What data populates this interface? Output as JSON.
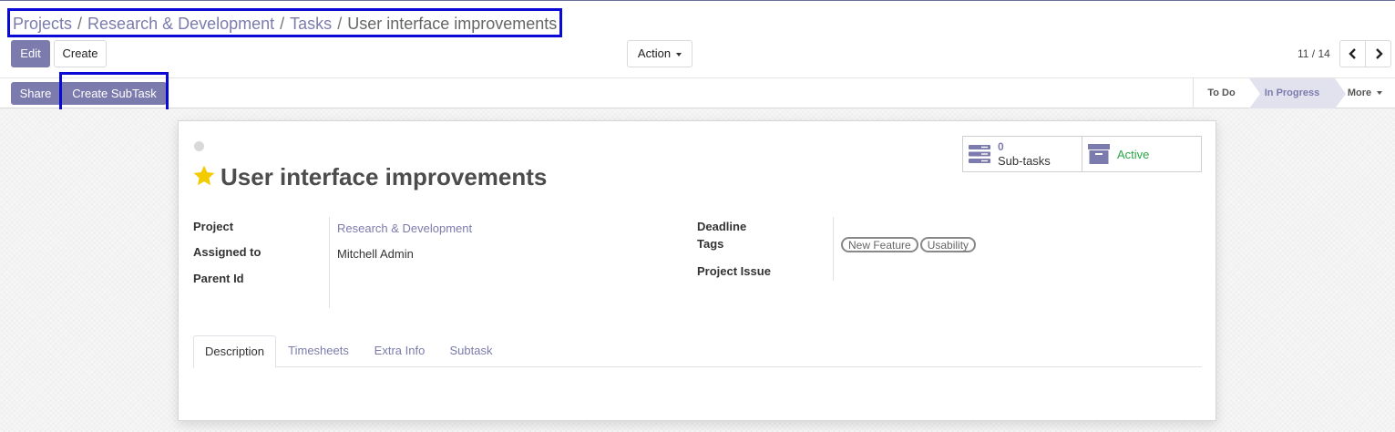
{
  "breadcrumb": {
    "items": [
      "Projects",
      "Research & Development",
      "Tasks"
    ],
    "separator": "/",
    "current": "User interface improvements"
  },
  "toolbar": {
    "edit_label": "Edit",
    "create_label": "Create",
    "action_label": "Action"
  },
  "pager": {
    "value": "11 / 14"
  },
  "header_buttons": {
    "share_label": "Share",
    "create_subtask_label": "Create SubTask"
  },
  "stages": {
    "todo": "To Do",
    "in_progress": "In Progress",
    "more": "More",
    "current": "In Progress"
  },
  "task": {
    "title": "User interface improvements",
    "favorite": true,
    "kanban_state_color": "#d9d9d9"
  },
  "stat_buttons": {
    "subtasks_count": "0",
    "subtasks_label": "Sub-tasks",
    "active_label": "Active"
  },
  "fields": {
    "project_label": "Project",
    "project_value": "Research & Development",
    "assigned_label": "Assigned to",
    "assigned_value": "Mitchell Admin",
    "parent_label": "Parent Id",
    "parent_value": "",
    "deadline_label": "Deadline",
    "deadline_value": "",
    "tags_label": "Tags",
    "tags": [
      "New Feature",
      "Usability"
    ],
    "project_issue_label": "Project Issue",
    "project_issue_value": ""
  },
  "tabs": [
    "Description",
    "Timesheets",
    "Extra Info",
    "Subtask"
  ],
  "active_tab": "Description",
  "colors": {
    "brand": "#7c7bad",
    "active_green": "#28a745",
    "star": "#f3cc00",
    "highlight_box": "#0a0ad6"
  }
}
